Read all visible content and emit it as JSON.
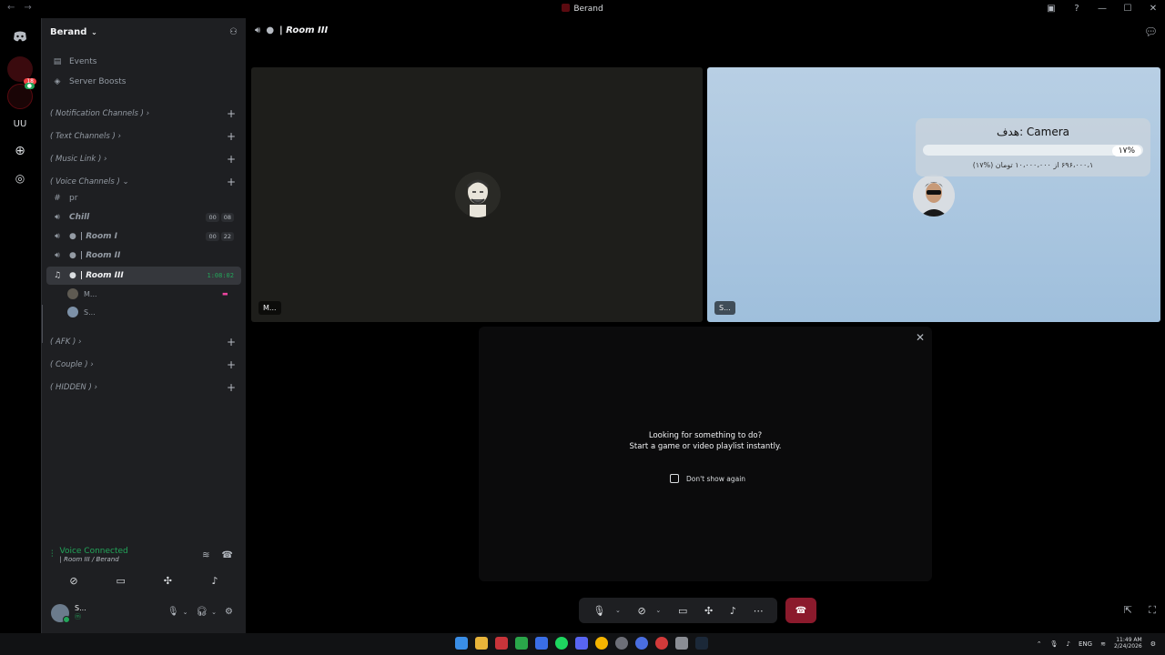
{
  "window": {
    "title": "Berand",
    "back_icon": "arrow-left-icon",
    "forward_icon": "arrow-right-icon"
  },
  "server": {
    "name": "Berand",
    "top_items": [
      {
        "label": "Events",
        "icon": "calendar-icon"
      },
      {
        "label": "Server Boosts",
        "icon": "boost-icon"
      }
    ],
    "categories_top": [
      {
        "label": "( Notification Channels )  ›"
      },
      {
        "label": "( Text Channels )  ›"
      },
      {
        "label": "( Music Link )  ›"
      },
      {
        "label": "( Voice Channels )  ⌄"
      }
    ],
    "channels": [
      {
        "label": "pr",
        "type": "text"
      },
      {
        "label": "Chill",
        "type": "voice",
        "badges": [
          "00",
          "08"
        ]
      },
      {
        "label": "| Room I",
        "type": "voice",
        "badges": [
          "00",
          "22"
        ]
      },
      {
        "label": "| Room II",
        "type": "voice",
        "badges": []
      },
      {
        "label": "| Room III",
        "type": "voice",
        "timer": "1:08:02",
        "active": true
      }
    ],
    "members": [
      {
        "name": "M..."
      },
      {
        "name": "S..."
      }
    ],
    "categories_bottom": [
      {
        "label": "( AFK )  ›"
      },
      {
        "label": "( Couple )  ›"
      },
      {
        "label": "( HIDDEN )  ›"
      }
    ]
  },
  "voice_panel": {
    "status": "Voice Connected",
    "location": "| Room III / Berand"
  },
  "user": {
    "name": "S...",
    "status": "ⓜ"
  },
  "main": {
    "channel_title": "| Room III",
    "tiles": [
      {
        "tag": "M..."
      },
      {
        "tag": "S..."
      }
    ],
    "goal": {
      "title": "هدف: Camera",
      "percent_label": "١٧%",
      "progress": 0.17,
      "amount": "١،۶۹۶،۰۰۰ از ١٠،٠٠٠،٠٠٠ تومان (%١٧)"
    },
    "activity": {
      "line1": "Looking for something to do?",
      "line2": "Start a game or video playlist instantly.",
      "checkbox_label": "Don't show again"
    }
  },
  "taskbar": {
    "language": "ENG",
    "time": "11:49 AM",
    "date": "2/24/2026"
  },
  "colors": {
    "accent_green": "#23a55a",
    "leave_red": "#8b1a2c",
    "sidebar_bg": "#1e1f22"
  }
}
